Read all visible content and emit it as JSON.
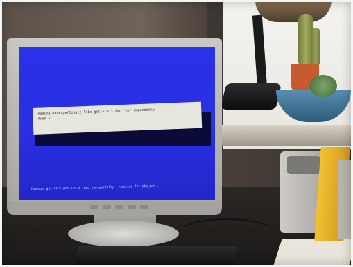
{
  "photo": {
    "subject": "monitor",
    "screen_color": "#2a2fe3"
  },
  "screen": {
    "dialog_text": "Adding package/libgcc-libc-gcc-5.0.3 for 'xx' dependency\nfrom x...",
    "status_line": "Package gcc-libc-gcc-5.0.3 read successfully - waiting for pkg_add..."
  }
}
